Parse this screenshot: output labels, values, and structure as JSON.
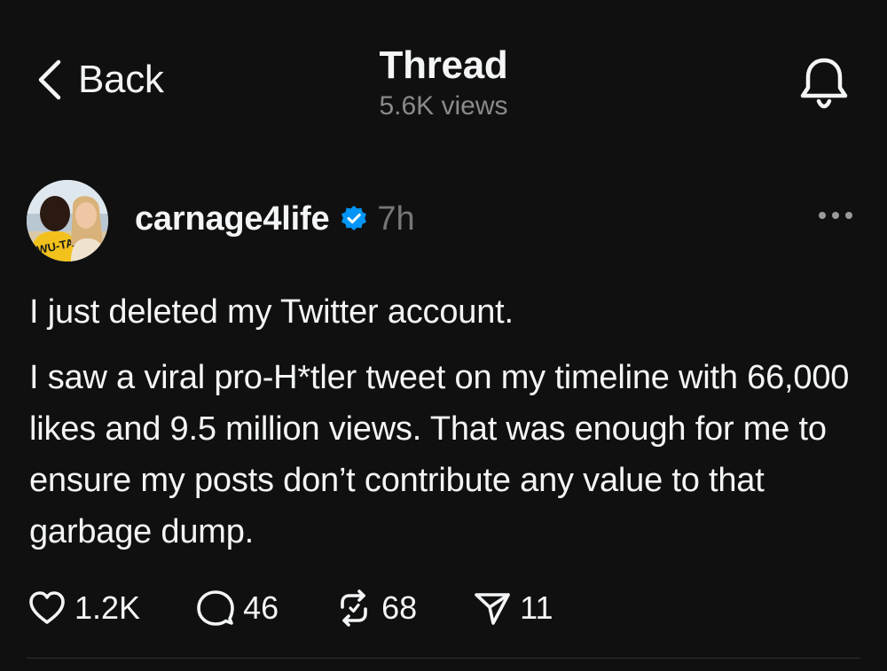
{
  "header": {
    "back_label": "Back",
    "title": "Thread",
    "views": "5.6K views"
  },
  "post": {
    "username": "carnage4life",
    "timestamp": "7h",
    "paragraphs": [
      "I just deleted my Twitter account.",
      "I saw a viral pro-H*tler tweet on my timeline with 66,000 likes and 9.5 million views. That was enough for me to ensure my posts don’t contribute any value to that garbage dump."
    ],
    "actions": {
      "likes": "1.2K",
      "replies": "46",
      "reposts": "68",
      "shares": "11"
    }
  },
  "colors": {
    "background": "#101010",
    "text": "#f3f5f7",
    "muted": "#8a8a8a",
    "verified": "#0095f6"
  },
  "icons": [
    "chevron-left-icon",
    "bell-icon",
    "verified-icon",
    "more-icon",
    "heart-icon",
    "comment-icon",
    "repost-icon",
    "share-icon"
  ]
}
